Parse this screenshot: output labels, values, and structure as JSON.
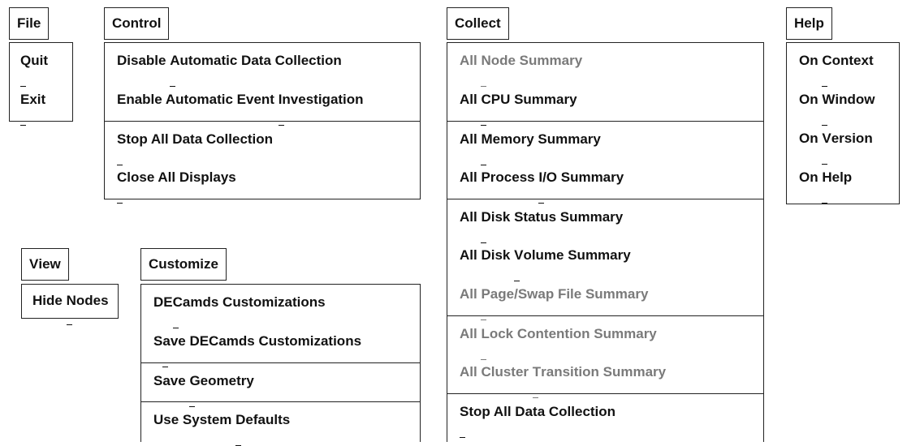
{
  "file": {
    "title": [
      "",
      "F",
      "ile"
    ],
    "items": [
      [
        "",
        "Q",
        "uit"
      ],
      [
        "",
        "E",
        "xit"
      ]
    ]
  },
  "control": {
    "title": [
      "",
      "C",
      "ontrol"
    ],
    "items": [
      [
        "Disable ",
        "A",
        "utomatic Data Collection"
      ],
      [
        "Enable Automatic Event ",
        "I",
        "nvestigation"
      ],
      [
        "",
        "S",
        "top All Data Collection"
      ],
      [
        "",
        "C",
        "lose All Displays"
      ]
    ]
  },
  "collect": {
    "title": [
      "Co",
      "l",
      "lect"
    ],
    "items": [
      [
        "All ",
        "N",
        "ode Summary"
      ],
      [
        "All ",
        "C",
        "PU Summary"
      ],
      [
        "All ",
        "M",
        "emory Summary"
      ],
      [
        "All Process ",
        "I",
        "/O Summary"
      ],
      [
        "All ",
        "D",
        "isk Status Summary"
      ],
      [
        "All Disk ",
        "V",
        "olume Summary"
      ],
      [
        "All ",
        "P",
        "age/Swap File Summary"
      ],
      [
        "All ",
        "L",
        "ock Contention Summary"
      ],
      [
        "All Cluster ",
        "T",
        "ransition Summary"
      ],
      [
        "",
        "S",
        "top All Data Collection"
      ]
    ]
  },
  "help": {
    "title": [
      "",
      "H",
      "elp"
    ],
    "items": [
      [
        "On ",
        "C",
        "ontext"
      ],
      [
        "On ",
        "W",
        "indow"
      ],
      [
        "On ",
        "V",
        "ersion"
      ],
      [
        "On ",
        "H",
        "elp"
      ]
    ]
  },
  "view": {
    "title": [
      "",
      "V",
      "iew"
    ],
    "items": [
      [
        "Hide ",
        "N",
        "odes"
      ]
    ]
  },
  "customize": {
    "title": [
      "Cu",
      "s",
      "tomize"
    ],
    "items": [
      [
        "DE",
        "C",
        "amds Customizations"
      ],
      [
        "S",
        "a",
        "ve DECamds Customizations"
      ],
      [
        "Save ",
        "G",
        "eometry"
      ],
      [
        "Use System ",
        "D",
        "efaults"
      ]
    ]
  }
}
